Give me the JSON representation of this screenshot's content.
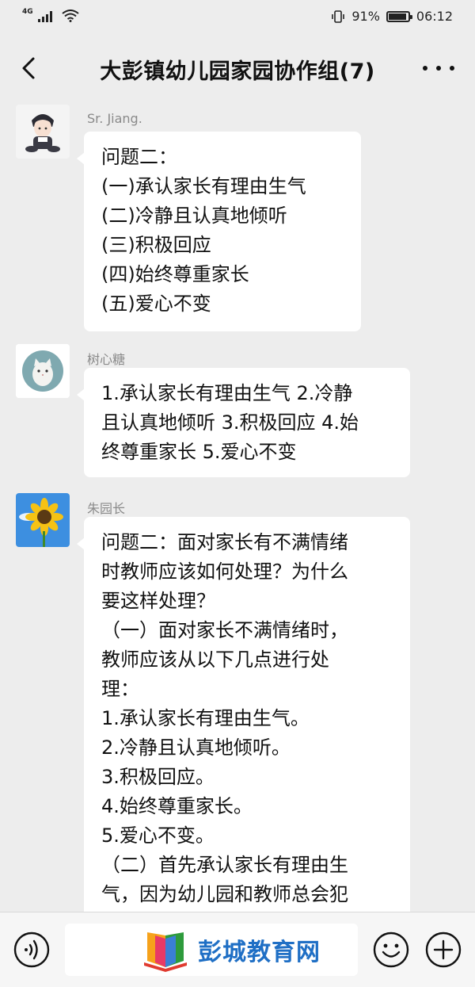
{
  "status_bar": {
    "network": "4G",
    "battery_percent": "91%",
    "battery_level": 0.91,
    "time": "06:12"
  },
  "nav": {
    "title": "大彭镇幼儿园家园协作组(7)"
  },
  "messages": [
    {
      "sender": "Sr. Jiang.",
      "avatar": "cartoon-boy-avatar",
      "lines": [
        "问题二：",
        "(一)承认家长有理由生气",
        "(二)冷静且认真地倾听",
        "(三)积极回应",
        "(四)始终尊重家长",
        "(五)爱心不变"
      ]
    },
    {
      "sender": "树心糖",
      "avatar": "cat-avatar",
      "lines": [
        "1.承认家长有理由生气 2.冷静",
        "且认真地倾听 3.积极回应 4.始",
        "终尊重家长 5.爱心不变"
      ]
    },
    {
      "sender": "朱园长",
      "avatar": "sunflower-avatar",
      "lines": [
        "问题二：面对家长有不满情绪",
        "时教师应该如何处理？为什么",
        "要这样处理？",
        "（一）面对家长不满情绪时，",
        "教师应该从以下几点进行处",
        "理：",
        "1.承认家长有理由生气。",
        "2.冷静且认真地倾听。",
        "3.积极回应。",
        "4.始终尊重家长。",
        "5.爱心不变。",
        "（二）首先承认家长有理由生",
        "气，因为幼儿园和教师总会犯"
      ]
    }
  ],
  "input_bar": {
    "voice_icon": "voice-icon",
    "emoji_icon": "emoji-icon",
    "plus_icon": "plus-icon"
  },
  "watermark": {
    "text": "彭城教育网"
  },
  "colors": {
    "background": "#ededed",
    "bubble": "#ffffff",
    "watermark_blue": "#1f6fc5"
  }
}
